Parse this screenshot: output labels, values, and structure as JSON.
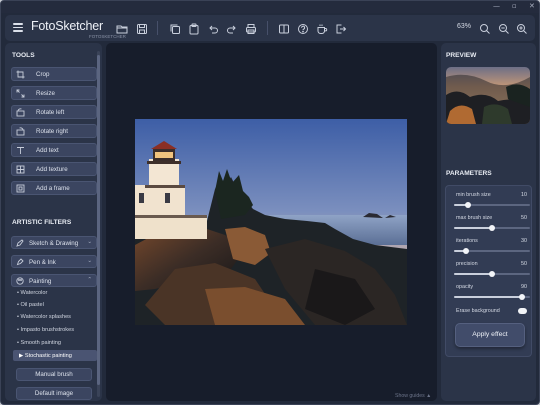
{
  "app": {
    "logo_text": "FotoSketcher",
    "logo_sub": "FOTOSKETCHER"
  },
  "window_controls": {
    "minimize": "—",
    "maximize": "▫",
    "close": "✕"
  },
  "toolbar": {
    "zoom": "63%",
    "icons": [
      "open-icon",
      "save-icon",
      "copy-icon",
      "paste-icon",
      "undo-icon",
      "redo-icon",
      "print-icon",
      "compare-icon",
      "help-icon",
      "coffee-icon",
      "exit-icon",
      "zoom-fit-icon",
      "zoom-out-icon",
      "zoom-in-icon"
    ]
  },
  "left_panel": {
    "tools_title": "TOOLS",
    "tools": [
      {
        "label": "Crop",
        "icon": "crop-icon"
      },
      {
        "label": "Resize",
        "icon": "resize-icon"
      },
      {
        "label": "Rotate left",
        "icon": "rotate-left-icon"
      },
      {
        "label": "Rotate right",
        "icon": "rotate-right-icon"
      },
      {
        "label": "Add text",
        "icon": "text-icon"
      },
      {
        "label": "Add texture",
        "icon": "texture-icon"
      },
      {
        "label": "Add a frame",
        "icon": "frame-icon"
      }
    ],
    "filters_title": "ARTISTIC FILTERS",
    "filters": [
      {
        "label": "Sketch & Drawing",
        "icon": "pencil-icon",
        "chevron": "⌄"
      },
      {
        "label": "Pen & Ink",
        "icon": "pen-icon",
        "chevron": "⌄"
      },
      {
        "label": "Painting",
        "icon": "palette-icon",
        "chevron": "⌃"
      }
    ],
    "painting_items": [
      "• Watercolor",
      "• Oil pastel",
      "• Watercolor splashes",
      "• Impasto brushstrokes",
      "• Smooth painting",
      "▶ Stochastic painting"
    ],
    "manual_brush": "Manual brush",
    "default_image": "Default image"
  },
  "canvas": {
    "show_guides": "Show guides ▲"
  },
  "right_panel": {
    "preview_title": "PREVIEW",
    "params_title": "PARAMETERS",
    "params": [
      {
        "label": "min brush size",
        "value": "10",
        "fraction": 0.18
      },
      {
        "label": "max brush size",
        "value": "50",
        "fraction": 0.5
      },
      {
        "label": "iterations",
        "value": "30",
        "fraction": 0.16
      },
      {
        "label": "precision",
        "value": "50",
        "fraction": 0.5
      },
      {
        "label": "opacity",
        "value": "90",
        "fraction": 0.9
      }
    ],
    "erase_label": "Erase background",
    "erase_on": true,
    "apply_label": "Apply effect"
  }
}
